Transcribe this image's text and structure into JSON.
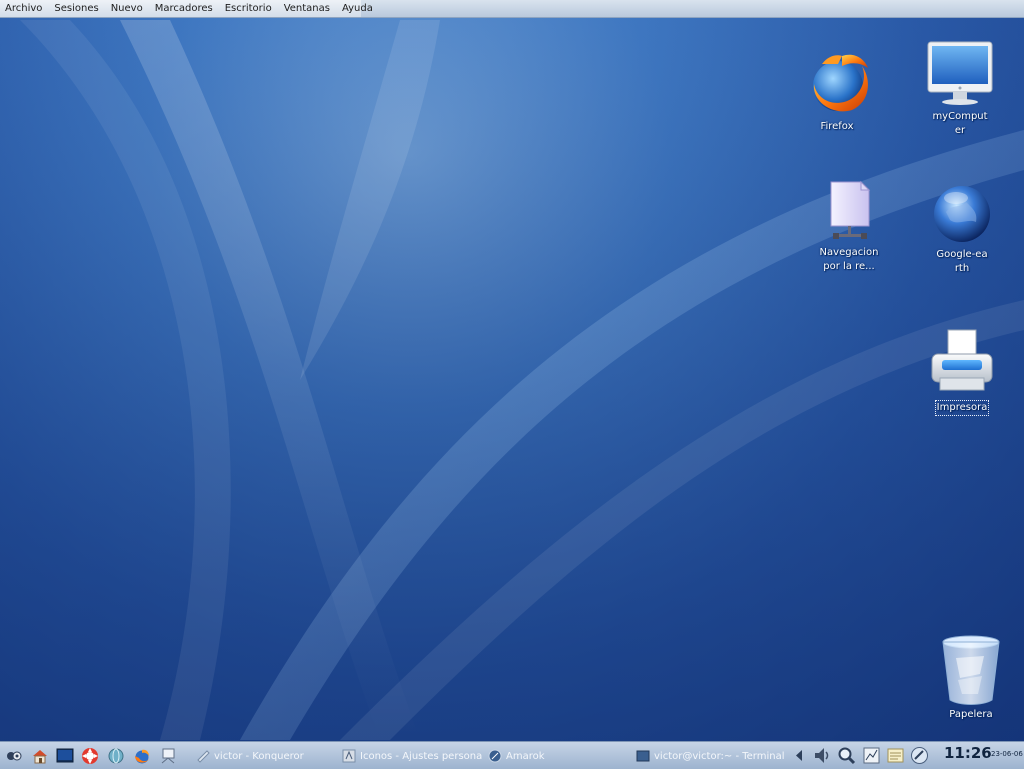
{
  "menubar": {
    "items": [
      "Archivo",
      "Sesiones",
      "Nuevo",
      "Marcadores",
      "Escritorio",
      "Ventanas",
      "Ayuda"
    ]
  },
  "desktop": {
    "icons": [
      {
        "label": "Firefox",
        "icon": "firefox-icon"
      },
      {
        "label": "myComputer",
        "icon": "computer-icon"
      },
      {
        "label": "Navegacion por la re...",
        "icon": "network-browsing-icon"
      },
      {
        "label": "Google-earth",
        "icon": "google-earth-icon"
      },
      {
        "label": "Impresora",
        "icon": "printer-icon"
      },
      {
        "label": "Papelera",
        "icon": "trash-icon"
      }
    ]
  },
  "taskbar": {
    "launchers": [
      "kde-menu-icon",
      "home-icon",
      "terminal-icon",
      "help-icon",
      "browser-icon",
      "firefox-icon",
      "network-icon"
    ],
    "tasks": [
      {
        "label": "victor - Konqueror",
        "icon": "konqueror-icon"
      },
      {
        "label": "Iconos - Ajustes personales",
        "icon": "settings-icon"
      },
      {
        "label": "Amarok",
        "icon": "amarok-icon"
      },
      {
        "label": "victor@victor:~ - Terminal",
        "icon": "terminal-icon"
      }
    ],
    "tray": [
      "tray-arrow-icon",
      "volume-icon",
      "search-icon",
      "network-monitor-icon",
      "notes-icon",
      "clipboard-icon"
    ],
    "clock": {
      "time": "11:26",
      "date": "23-06-06"
    }
  },
  "colors": {
    "wallpaper": "#2a5aa8",
    "taskbar": "#b0c2da",
    "menubar": "#d9e3ee"
  }
}
